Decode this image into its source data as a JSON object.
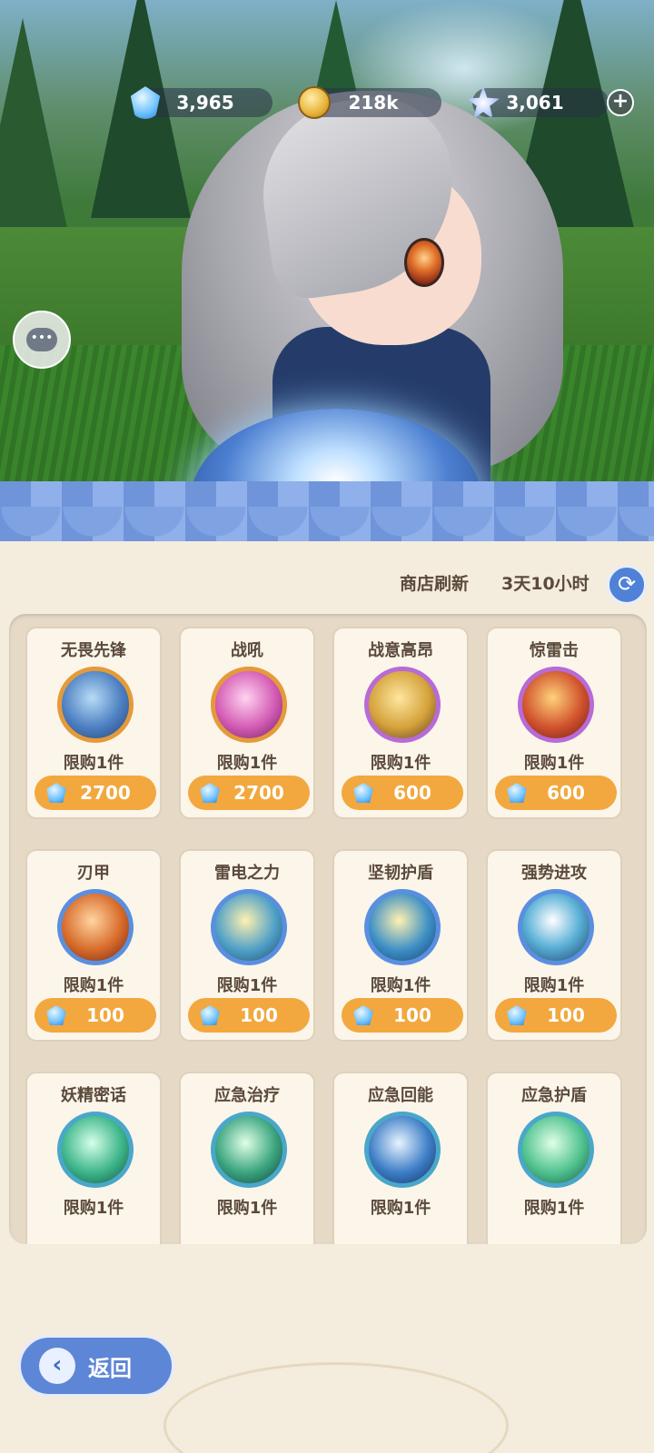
{
  "currency": {
    "gems": "3,965",
    "coins": "218k",
    "stars": "3,061",
    "add_label": "+"
  },
  "shop": {
    "refresh_label": "商店刷新",
    "refresh_time": "3天10小时"
  },
  "items": [
    {
      "name": "无畏先锋",
      "limit": "限购1件",
      "price": "2700",
      "ring": "#e59a3a",
      "fill": "radial-gradient(circle at 45% 40%, #b7dcf5, #4c7fc2 55%, #23406f)"
    },
    {
      "name": "战吼",
      "limit": "限购1件",
      "price": "2700",
      "ring": "#e59a3a",
      "fill": "radial-gradient(circle at 45% 40%, #ffd3f0, #d35bb4 55%, #6b1f5c)"
    },
    {
      "name": "战意高昂",
      "limit": "限购1件",
      "price": "600",
      "ring": "#b76bd6",
      "fill": "radial-gradient(circle at 45% 40%, #ffe6a0, #d4a23a 55%, #5b3a2a)"
    },
    {
      "name": "惊雷击",
      "limit": "限购1件",
      "price": "600",
      "ring": "#b76bd6",
      "fill": "radial-gradient(circle at 45% 40%, #ffd27a, #d0512c 55%, #6a1c1a)"
    },
    {
      "name": "刃甲",
      "limit": "限购1件",
      "price": "100",
      "ring": "#5a8fe0",
      "fill": "radial-gradient(circle at 45% 40%, #ffd5a0, #d76a2a 55%, #6b2416)"
    },
    {
      "name": "雷电之力",
      "limit": "限购1件",
      "price": "100",
      "ring": "#5a8fe0",
      "fill": "radial-gradient(circle at 45% 40%, #fff1b0, #4fa0c8 55%, #1d4c6a)"
    },
    {
      "name": "坚韧护盾",
      "limit": "限购1件",
      "price": "100",
      "ring": "#5a8fe0",
      "fill": "radial-gradient(circle at 45% 40%, #fff2b0, #3c8fc6 55%, #1a3f6a)"
    },
    {
      "name": "强势进攻",
      "limit": "限购1件",
      "price": "100",
      "ring": "#5a8fe0",
      "fill": "radial-gradient(circle at 45% 40%, #ffffff, #5ab0d6 50%, #1c3f6a)"
    },
    {
      "name": "妖精密话",
      "limit": "限购1件",
      "price": "",
      "ring": "#4aa7c9",
      "fill": "radial-gradient(circle at 45% 40%, #d6ffe8, #3db58a 55%, #14523f)"
    },
    {
      "name": "应急治疗",
      "limit": "限购1件",
      "price": "",
      "ring": "#4aa7c9",
      "fill": "radial-gradient(circle at 45% 40%, #e0ffe8, #3aa47e 55%, #123f3a)"
    },
    {
      "name": "应急回能",
      "limit": "限购1件",
      "price": "",
      "ring": "#4aa7c9",
      "fill": "radial-gradient(circle at 45% 40%, #e8f4ff, #3d7dc6 55%, #10305a)"
    },
    {
      "name": "应急护盾",
      "limit": "限购1件",
      "price": "",
      "ring": "#4aa7c9",
      "fill": "radial-gradient(circle at 45% 40%, #e0ffe8, #4fc28e 55%, #1a5a44)"
    }
  ],
  "back_label": "返回",
  "icons": {
    "gem": "gem-icon",
    "coin": "coin-icon",
    "star": "star-crystal-icon",
    "chat": "chat-icon",
    "refresh": "refresh-icon",
    "back": "chevron-left-icon"
  },
  "colors": {
    "accent_blue": "#5e86d6",
    "price_orange": "#f2a83e",
    "panel_bg": "#f4ecdd",
    "text_brown": "#5b4a3c"
  }
}
